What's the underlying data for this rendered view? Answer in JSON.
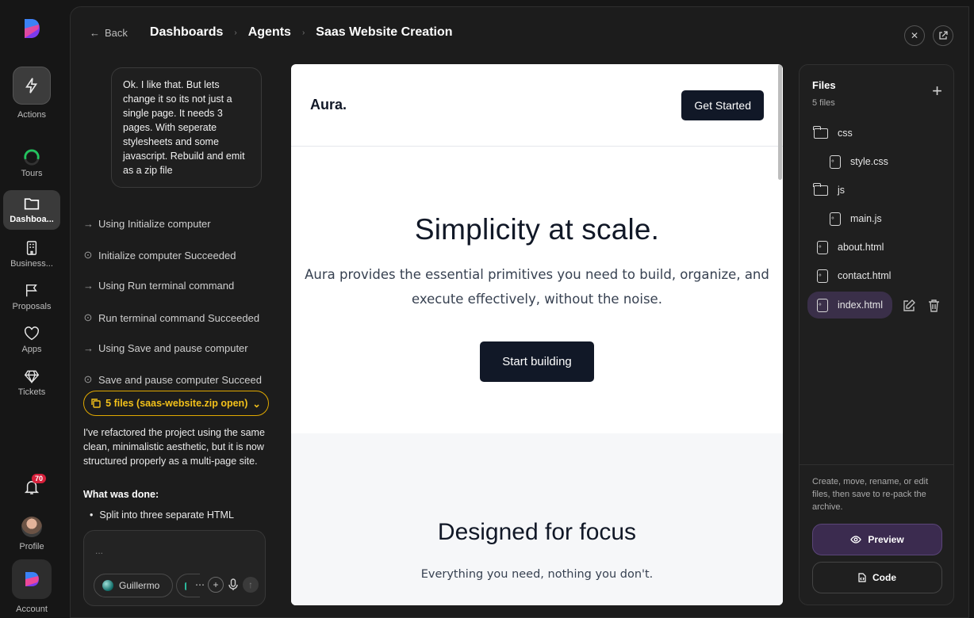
{
  "rail": {
    "items": [
      {
        "label": "Actions",
        "icon": "bolt-icon"
      },
      {
        "label": "Tours",
        "icon": "progress-ring-icon"
      },
      {
        "label": "Dashboa...",
        "icon": "folder-icon"
      },
      {
        "label": "Business...",
        "icon": "building-icon"
      },
      {
        "label": "Proposals",
        "icon": "flag-icon"
      },
      {
        "label": "Apps",
        "icon": "heart-icon"
      },
      {
        "label": "Tickets",
        "icon": "gem-icon"
      }
    ],
    "notifications_badge": "70",
    "profile_label": "Profile",
    "account_label": "Account"
  },
  "header": {
    "back_label": "Back",
    "breadcrumbs": [
      "Dashboards",
      "Agents",
      "Saas Website Creation"
    ]
  },
  "chat": {
    "user_message": "Ok. I like that. But lets change it so its not just a single page. It needs 3 pages. With seperate stylesheets and some javascript. Rebuild and emit as a zip file",
    "steps": [
      {
        "type": "using",
        "text": "Using Initialize computer"
      },
      {
        "type": "done",
        "text": "Initialize computer Succeeded"
      },
      {
        "type": "using",
        "text": "Using Run terminal command"
      },
      {
        "type": "done",
        "text": "Run terminal command Succeeded"
      },
      {
        "type": "using",
        "text": "Using Save and pause computer"
      },
      {
        "type": "done",
        "text": "Save and pause computer Succeed"
      }
    ],
    "files_pill": "5 files (saas-website.zip open)",
    "reply": "I've refactored the project using the same clean, minimalistic aesthetic, but it is now structured properly as a multi-page site.",
    "reply_heading": "What was done:",
    "reply_bullet": "Split into three separate HTML",
    "composer_placeholder": "...",
    "model_name": "Guillermo"
  },
  "preview": {
    "brand": "Aura.",
    "header_cta": "Get Started",
    "hero_title": "Simplicity at scale.",
    "hero_text": "Aura provides the essential primitives you need to build, organize, and execute effectively, without the noise.",
    "hero_button": "Start building",
    "section_title": "Designed for focus",
    "section_text": "Everything you need, nothing you don't."
  },
  "files": {
    "title": "Files",
    "count": "5 files",
    "tree": [
      {
        "name": "css",
        "kind": "folder"
      },
      {
        "name": "style.css",
        "kind": "file"
      },
      {
        "name": "js",
        "kind": "folder"
      },
      {
        "name": "main.js",
        "kind": "file"
      },
      {
        "name": "about.html",
        "kind": "file"
      },
      {
        "name": "contact.html",
        "kind": "file"
      },
      {
        "name": "index.html",
        "kind": "file",
        "selected": true
      }
    ],
    "help_text": "Create, move, rename, or edit files, then save to re-pack the archive.",
    "preview_button": "Preview",
    "code_button": "Code"
  },
  "colors": {
    "accent_gold": "#f2c01a",
    "selection_purple": "#3b2b4f",
    "badge_red": "#d61f3a",
    "preview_dark": "#111827"
  }
}
